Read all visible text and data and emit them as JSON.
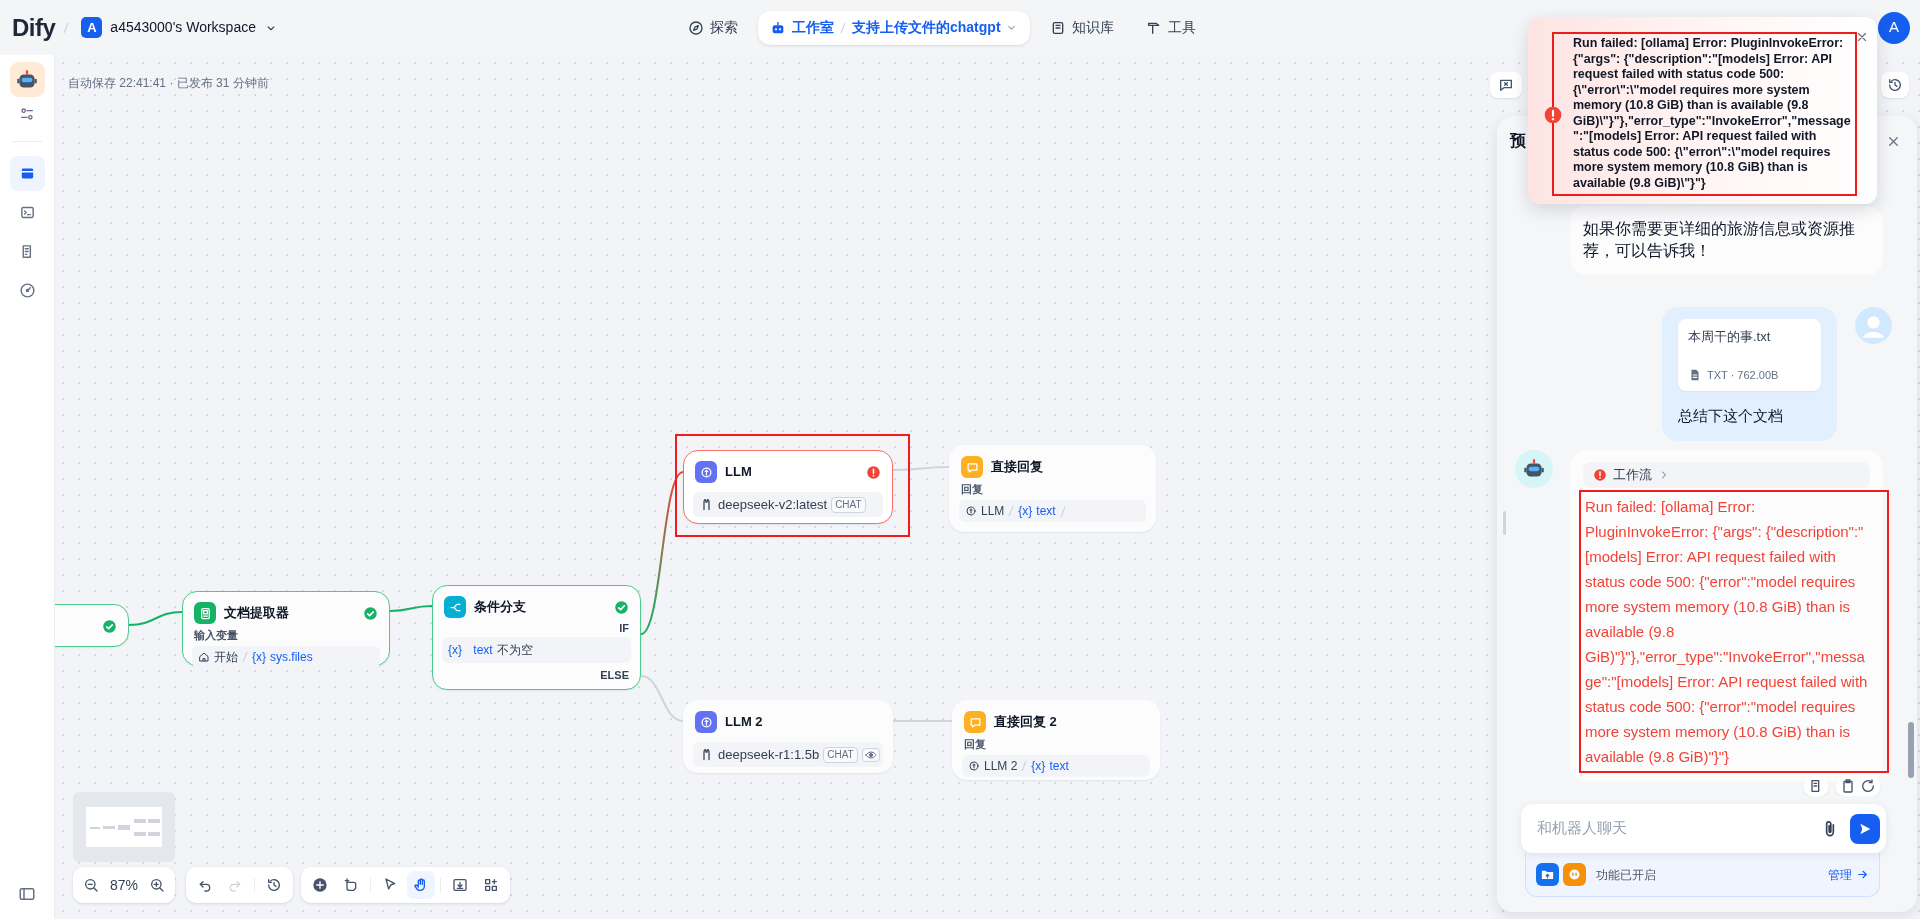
{
  "header": {
    "logo": "Dify",
    "workspace": {
      "initial": "A",
      "name": "a4543000's Workspace"
    },
    "nav": [
      {
        "kind": "explore",
        "label": "探索",
        "selected": false
      },
      {
        "kind": "studio",
        "label": "工作室",
        "app": "支持上传文件的chatgpt",
        "selected": true
      },
      {
        "kind": "datasets",
        "label": "知识库",
        "selected": false
      },
      {
        "kind": "tools",
        "label": "工具",
        "selected": false
      }
    ],
    "user": {
      "initial": "A"
    }
  },
  "sidebar": {
    "items": [
      {
        "kind": "workflow",
        "selected": true
      },
      {
        "kind": "api",
        "selected": false
      },
      {
        "kind": "logs",
        "selected": false
      },
      {
        "kind": "monitor",
        "selected": false
      }
    ]
  },
  "status_text": "自动保存 22:41:41 · 已发布 31 分钟前",
  "nodes": [
    {
      "kind": "start",
      "success": true,
      "error": false,
      "highlighted": false
    },
    {
      "kind": "doc-extractor",
      "title": "文档提取器",
      "success": true,
      "error": false,
      "highlighted": false,
      "label": "输入变量",
      "ref": {
        "kind": "start",
        "source": "开始",
        "mark": "{x}",
        "var": "sys.files",
        "trailing_divider": false
      }
    },
    {
      "kind": "if-else",
      "title": "条件分支",
      "success": true,
      "error": false,
      "highlighted": false,
      "branches": [
        "IF",
        "ELSE"
      ],
      "condition": {
        "mark": "{x}",
        "var": "text",
        "op": "不为空"
      }
    },
    {
      "kind": "llm",
      "title": "LLM",
      "success": false,
      "error": true,
      "highlighted": true,
      "model": "deepseek-v2:latest",
      "mode": "CHAT",
      "vision": false
    },
    {
      "kind": "llm",
      "title": "LLM 2",
      "success": false,
      "error": false,
      "highlighted": false,
      "model": "deepseek-r1:1.5b",
      "mode": "CHAT",
      "vision": true
    },
    {
      "kind": "answer",
      "title": "直接回复",
      "success": false,
      "error": false,
      "highlighted": false,
      "label": "回复",
      "ref": {
        "kind": "llm",
        "source": "LLM",
        "mark": "{x}",
        "var": "text",
        "trailing_divider": true
      }
    },
    {
      "kind": "answer",
      "title": "直接回复 2",
      "success": false,
      "error": false,
      "highlighted": false,
      "label": "回复",
      "ref": {
        "kind": "llm",
        "source": "LLM 2",
        "mark": "{x}",
        "var": "text",
        "trailing_divider": false
      }
    }
  ],
  "edges": [
    {
      "kind": "passed"
    },
    {
      "kind": "passed"
    },
    {
      "kind": "failed"
    },
    {
      "kind": "idle"
    },
    {
      "kind": "idle"
    },
    {
      "kind": "idle"
    }
  ],
  "zoom": {
    "reading": "87%"
  },
  "history_controls": [
    {
      "kind": "undo",
      "disabled": false
    },
    {
      "kind": "redo",
      "disabled": true
    },
    {
      "kind": "versions",
      "disabled": false
    }
  ],
  "tools": [
    {
      "kind": "add",
      "selected": false
    },
    {
      "kind": "note",
      "selected": false
    },
    {
      "kind": "pointer",
      "selected": false
    },
    {
      "kind": "hand",
      "selected": true
    },
    {
      "kind": "export",
      "selected": false
    },
    {
      "kind": "layout",
      "selected": false
    }
  ],
  "preview": {
    "title": "预",
    "messages": [
      {
        "kind": "bot",
        "text": "如果你需要更详细的旅游信息或资源推荐，可以告诉我！",
        "error": false,
        "highlighted": false
      },
      {
        "kind": "user",
        "file": {
          "name": "本周干的事.txt",
          "meta": "TXT · 762.00B"
        },
        "text": "总结下这个文档"
      },
      {
        "kind": "bot",
        "workflow": {
          "label": "工作流",
          "error": true
        },
        "text": "Run failed: [ollama] Error: PluginInvokeError: {\"args\": {\"description\":\"[models] Error: API request failed with status code 500: {\"error\":\"model requires more system memory (10.8 GiB) than is available (9.8 GiB)\"}\"},\"error_type\":\"InvokeError\",\"message\":\"[models] Error: API request failed with status code 500: {\"error\":\"model requires more system memory (10.8 GiB) than is available (9.8 GiB)\"}\"}",
        "error": true,
        "highlighted": true,
        "actions": [
          {
            "kind": "log"
          },
          {
            "kind": "copy"
          },
          {
            "kind": "regenerate"
          }
        ]
      }
    ],
    "input": {
      "placeholder": "和机器人聊天"
    },
    "features": {
      "items": [
        {
          "kind": "upload",
          "color": "#1570ef"
        },
        {
          "kind": "opener",
          "color": "#f79009"
        }
      ],
      "label": "功能已开启",
      "link": "管理"
    }
  },
  "toast": {
    "kind": "error",
    "highlighted": true,
    "text": "Run failed: [ollama] Error: PluginInvokeError: {\"args\": {\"description\":\"[models] Error: API request failed with status code 500: {\\\"error\\\":\\\"model requires more system memory (10.8 GiB) than is available (9.8 GiB)\\\"}\"},\"error_type\":\"InvokeError\",\"message\":\"[models] Error: API request failed with status code 500: {\\\"error\\\":\\\"model requires more system memory (10.8 GiB) than is available (9.8 GiB)\\\"}\"}"
  }
}
